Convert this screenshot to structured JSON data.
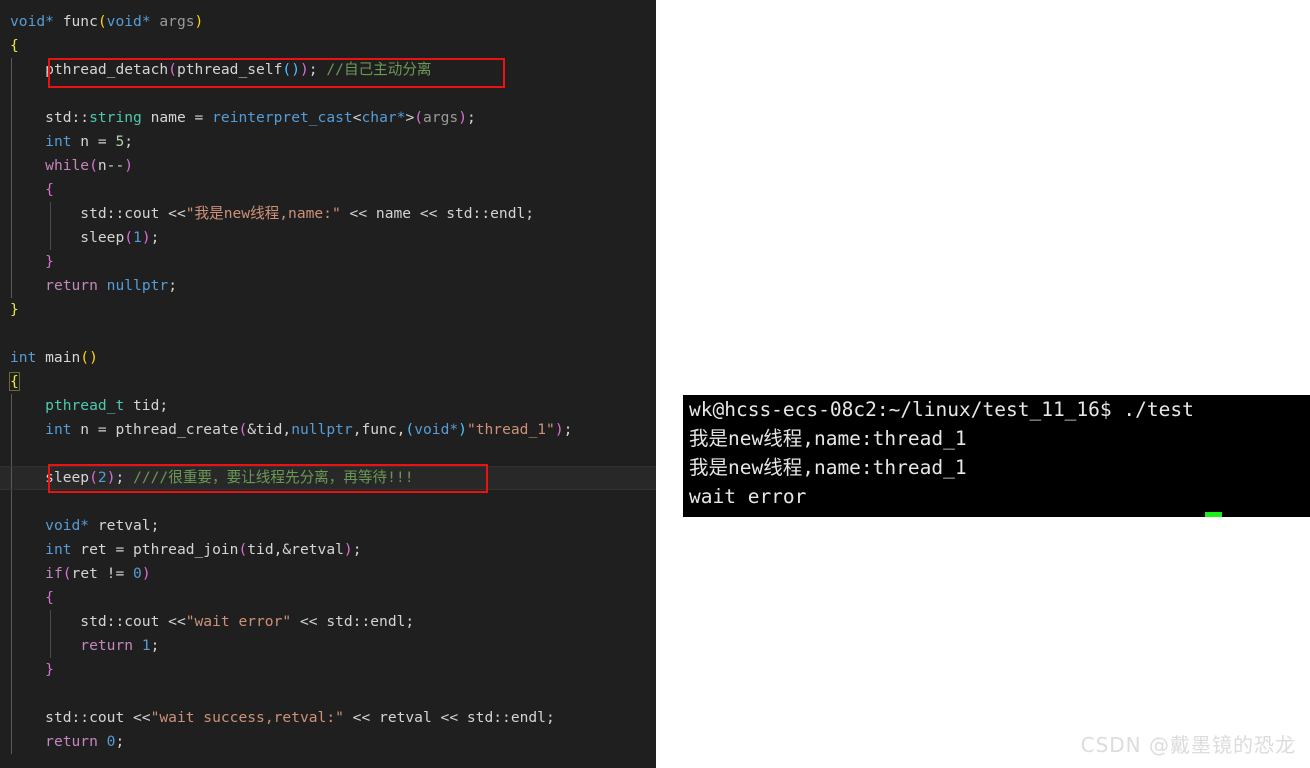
{
  "editor": {
    "background": "#1f1f1f",
    "lines": [
      {
        "id": "l1",
        "indent": 0,
        "text": "void* func(void* args)"
      },
      {
        "id": "l2",
        "indent": 0,
        "text": "{"
      },
      {
        "id": "l3",
        "indent": 1,
        "text": "pthread_detach(pthread_self()); //自己主动分离"
      },
      {
        "id": "l4",
        "indent": 0,
        "text": ""
      },
      {
        "id": "l5",
        "indent": 1,
        "text": "std::string name = reinterpret_cast<char*>(args);"
      },
      {
        "id": "l6",
        "indent": 1,
        "text": "int n = 5;"
      },
      {
        "id": "l7",
        "indent": 1,
        "text": "while(n--)"
      },
      {
        "id": "l8",
        "indent": 1,
        "text": "{"
      },
      {
        "id": "l9",
        "indent": 2,
        "text": "std::cout <<\"我是new线程,name:\" << name << std::endl;"
      },
      {
        "id": "l10",
        "indent": 2,
        "text": "sleep(1);"
      },
      {
        "id": "l11",
        "indent": 1,
        "text": "}"
      },
      {
        "id": "l12",
        "indent": 1,
        "text": "return nullptr;"
      },
      {
        "id": "l13",
        "indent": 0,
        "text": "}"
      },
      {
        "id": "l14",
        "indent": 0,
        "text": ""
      },
      {
        "id": "l15",
        "indent": 0,
        "text": "int main()"
      },
      {
        "id": "l16",
        "indent": 0,
        "text": "{"
      },
      {
        "id": "l17",
        "indent": 1,
        "text": "pthread_t tid;"
      },
      {
        "id": "l18",
        "indent": 1,
        "text": "int n = pthread_create(&tid,nullptr,func,(void*)\"thread_1\");"
      },
      {
        "id": "l19",
        "indent": 0,
        "text": ""
      },
      {
        "id": "l20",
        "indent": 1,
        "text": "sleep(2); ////很重要，要让线程先分离，再等待!!!"
      },
      {
        "id": "l21",
        "indent": 0,
        "text": ""
      },
      {
        "id": "l22",
        "indent": 1,
        "text": "void* retval;"
      },
      {
        "id": "l23",
        "indent": 1,
        "text": "int ret = pthread_join(tid,&retval);"
      },
      {
        "id": "l24",
        "indent": 1,
        "text": "if(ret != 0)"
      },
      {
        "id": "l25",
        "indent": 1,
        "text": "{"
      },
      {
        "id": "l26",
        "indent": 2,
        "text": "std::cout <<\"wait error\" << std::endl;"
      },
      {
        "id": "l27",
        "indent": 2,
        "text": "return 1;"
      },
      {
        "id": "l28",
        "indent": 1,
        "text": "}"
      },
      {
        "id": "l29",
        "indent": 0,
        "text": ""
      },
      {
        "id": "l30",
        "indent": 1,
        "text": "std::cout <<\"wait success,retval:\" << retval << std::endl;"
      },
      {
        "id": "l31",
        "indent": 1,
        "text": "return 0;"
      }
    ],
    "annotations": [
      {
        "id": "box-detach",
        "label": "pthread_detach-highlight-box",
        "color": "#ee1111"
      },
      {
        "id": "box-sleep",
        "label": "sleep2-highlight-box",
        "color": "#ee1111"
      }
    ],
    "highlighted_line_id": "l20"
  },
  "terminal": {
    "background": "#000000",
    "foreground": "#e6e6e6",
    "cursor_color": "#19f019",
    "prompt_user_host": "wk@hcss-ecs-08c2",
    "prompt_path": "~/linux/test_11_16",
    "prompt_symbol": "$",
    "command": "./test",
    "lines": [
      "wk@hcss-ecs-08c2:~/linux/test_11_16$ ./test",
      "我是new线程,name:thread_1",
      "我是new线程,name:thread_1",
      "wait error"
    ]
  },
  "watermark": {
    "text": "CSDN @戴墨镜的恐龙",
    "color": "#dcdcdc"
  }
}
